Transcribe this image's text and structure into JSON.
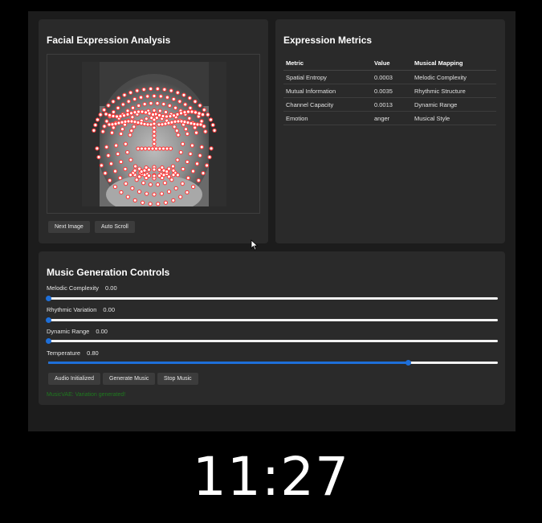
{
  "face_panel": {
    "title": "Facial Expression Analysis",
    "buttons": {
      "next": "Next Image",
      "auto_scroll": "Auto Scroll"
    }
  },
  "metrics_panel": {
    "title": "Expression Metrics",
    "headers": [
      "Metric",
      "Value",
      "Musical Mapping"
    ],
    "rows": [
      [
        "Spatial Entropy",
        "0.0003",
        "Melodic Complexity"
      ],
      [
        "Mutual Information",
        "0.0035",
        "Rhythmic Structure"
      ],
      [
        "Channel Capacity",
        "0.0013",
        "Dynamic Range"
      ],
      [
        "Emotion",
        "anger",
        "Musical Style"
      ]
    ]
  },
  "music_panel": {
    "title": "Music Generation Controls",
    "controls": [
      {
        "label": "Melodic Complexity",
        "value": "0.00",
        "level": 0.0
      },
      {
        "label": "Rhythmic Variation",
        "value": "0.00",
        "level": 0.0
      },
      {
        "label": "Dynamic Range",
        "value": "0.00",
        "level": 0.0
      },
      {
        "label": "Temperature",
        "value": "0.80",
        "level": 0.8
      }
    ],
    "buttons": {
      "audio": "Audio Initialized",
      "generate": "Generate Music",
      "stop": "Stop Music"
    },
    "status": "MusicVAE: Variation generated!"
  },
  "clock": {
    "time": "11:27"
  },
  "colors": {
    "accent": "#1e6fd9",
    "landmark": "#ff3b3b",
    "status": "#1f7a1f"
  }
}
